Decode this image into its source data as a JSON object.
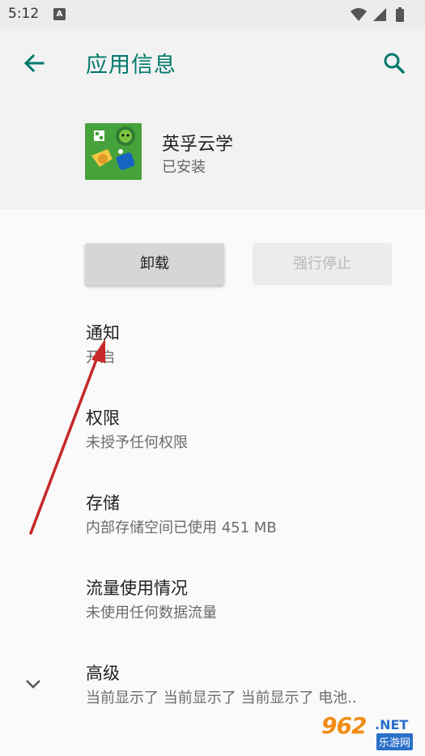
{
  "status_bar": {
    "time": "5:12",
    "notification_icon": "A"
  },
  "app_bar": {
    "title": "应用信息",
    "back_icon": "arrow-left-icon",
    "search_icon": "search-icon"
  },
  "app": {
    "name": "英孚云学",
    "status": "已安装"
  },
  "buttons": {
    "uninstall": "卸载",
    "force_stop": "强行停止"
  },
  "items": [
    {
      "title": "通知",
      "subtitle": "开启"
    },
    {
      "title": "权限",
      "subtitle": "未授予任何权限"
    },
    {
      "title": "存储",
      "subtitle": "内部存储空间已使用 451 MB"
    },
    {
      "title": "流量使用情况",
      "subtitle": "未使用任何数据流量"
    },
    {
      "title": "高级",
      "subtitle": "当前显示了 当前显示了 当前显示了 电池.."
    }
  ],
  "watermark": {
    "number": "962",
    "domain": ".NET",
    "label": "乐游网"
  },
  "colors": {
    "accent": "#00796b",
    "annotation_arrow": "#c62828"
  }
}
